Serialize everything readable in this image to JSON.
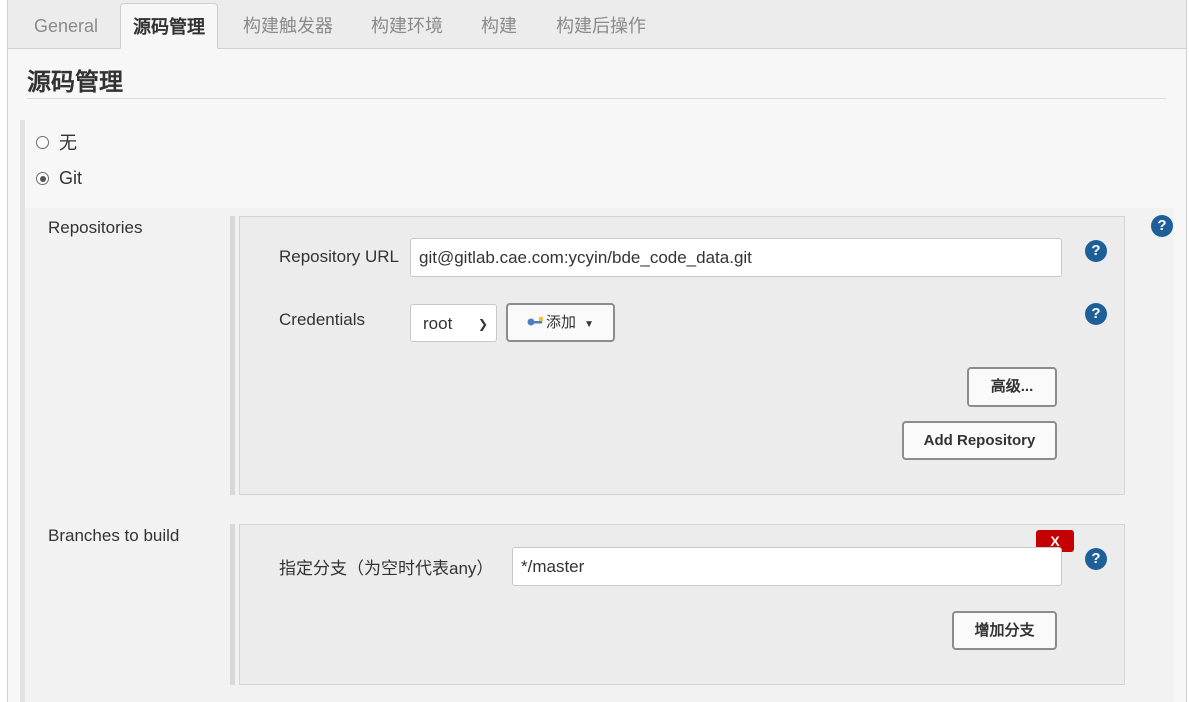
{
  "tabs": [
    {
      "label": "General",
      "active": false
    },
    {
      "label": "源码管理",
      "active": true
    },
    {
      "label": "构建触发器",
      "active": false
    },
    {
      "label": "构建环境",
      "active": false
    },
    {
      "label": "构建",
      "active": false
    },
    {
      "label": "构建后操作",
      "active": false
    }
  ],
  "section": {
    "title": "源码管理"
  },
  "scm_options": {
    "none_label": "无",
    "git_label": "Git",
    "selected": "Git"
  },
  "repositories": {
    "label": "Repositories",
    "url_label": "Repository URL",
    "url_value": "git@gitlab.cae.com:ycyin/bde_code_data.git",
    "credentials_label": "Credentials",
    "credentials_value": "root",
    "add_label": "添加",
    "advanced_label": "高级...",
    "add_repository_label": "Add Repository"
  },
  "branches": {
    "label": "Branches to build",
    "spec_label": "指定分支（为空时代表any）",
    "spec_value": "*/master",
    "delete_label": "X",
    "add_branch_label": "增加分支"
  },
  "help_glyph": "?",
  "colors": {
    "help": "#1f5f99",
    "delete": "#c40000"
  }
}
